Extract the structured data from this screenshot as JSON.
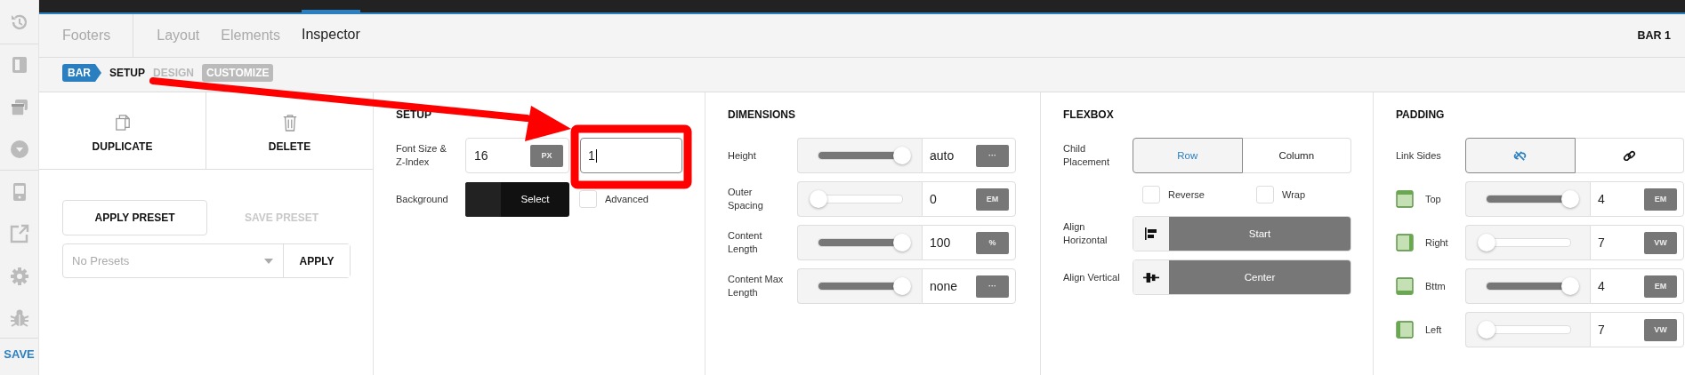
{
  "sidebar": {
    "save": "SAVE"
  },
  "tabs": [
    {
      "label": "Footers",
      "kind": "section",
      "selected": false
    },
    {
      "label": "Layout",
      "kind": "tab",
      "selected": false
    },
    {
      "label": "Elements",
      "kind": "tab",
      "selected": false
    },
    {
      "label": "Inspector",
      "kind": "tab",
      "selected": true
    }
  ],
  "context_title": "BAR 1",
  "breadcrumb": {
    "badge": "BAR",
    "steps": [
      {
        "label": "SETUP",
        "kind": "step",
        "selected": true
      },
      {
        "label": "DESIGN",
        "kind": "step",
        "selected": false
      },
      {
        "label": "CUSTOMIZE",
        "kind": "pill",
        "selected": false
      }
    ]
  },
  "actions": [
    {
      "label": "DUPLICATE",
      "kind": "duplicate"
    },
    {
      "label": "DELETE",
      "kind": "delete"
    }
  ],
  "presets": {
    "apply_preset": "APPLY PRESET",
    "save_preset": {
      "label": "SAVE PRESET",
      "disabled": true
    },
    "select": {
      "placeholder": "No Presets"
    },
    "apply": "APPLY"
  },
  "setup": {
    "title": "SETUP",
    "font_label": "Font Size & Z-Index",
    "font_size": "16",
    "font_unit": "PX",
    "z_index": "1",
    "background_label": "Background",
    "background_button": "Select",
    "advanced": {
      "label": "Advanced",
      "checked": false
    }
  },
  "dimensions": {
    "title": "DIMENSIONS",
    "rows": [
      {
        "label": "Height",
        "level": 1,
        "value": "auto",
        "unit": "···"
      },
      {
        "label": "Outer Spacing",
        "level": 0,
        "value": "0",
        "unit": "EM"
      },
      {
        "label": "Content Length",
        "level": 1,
        "value": "100",
        "unit": "%"
      },
      {
        "label": "Content Max Length",
        "level": 1,
        "value": "none",
        "unit": "···"
      }
    ]
  },
  "flexbox": {
    "title": "FLEXBOX",
    "placement": {
      "label": "Child Placement",
      "options": [
        {
          "label": "Row",
          "selected": true
        },
        {
          "label": "Column",
          "selected": false
        }
      ]
    },
    "checkboxes": [
      {
        "label": "Reverse",
        "checked": false
      },
      {
        "label": "Wrap",
        "checked": false
      }
    ],
    "align": [
      {
        "label": "Align Horizontal",
        "value": "Start",
        "kind": "horizontal"
      },
      {
        "label": "Align Vertical",
        "value": "Center",
        "kind": "vertical"
      }
    ]
  },
  "padding": {
    "title": "PADDING",
    "link": {
      "label": "Link Sides",
      "options": [
        {
          "kind": "unlink",
          "selected": true
        },
        {
          "kind": "link",
          "selected": false
        }
      ]
    },
    "rows": [
      {
        "label": "Top",
        "kind": "top",
        "level": 1,
        "value": "4",
        "unit": "EM"
      },
      {
        "label": "Right",
        "kind": "right",
        "level": 0,
        "value": "7",
        "unit": "VW"
      },
      {
        "label": "Bttm",
        "kind": "bottom",
        "level": 1,
        "value": "4",
        "unit": "EM"
      },
      {
        "label": "Left",
        "kind": "left",
        "level": 0,
        "value": "7",
        "unit": "VW"
      }
    ]
  }
}
